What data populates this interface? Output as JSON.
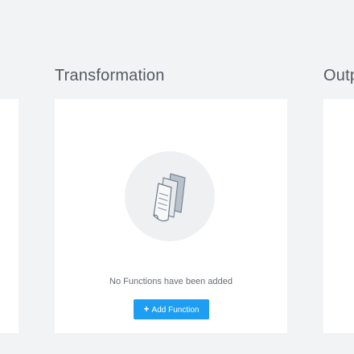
{
  "sections": {
    "transformation": {
      "title": "Transformation",
      "empty_icon": "documents-icon",
      "empty_message": "No Functions have been added",
      "add_button": {
        "icon": "+",
        "label": "Add Function"
      }
    },
    "output": {
      "title_visible": "Outp"
    }
  },
  "colors": {
    "background": "#f2f3f4",
    "panel": "#ffffff",
    "accent": "#1e9ef2",
    "title_text": "#535a63"
  }
}
